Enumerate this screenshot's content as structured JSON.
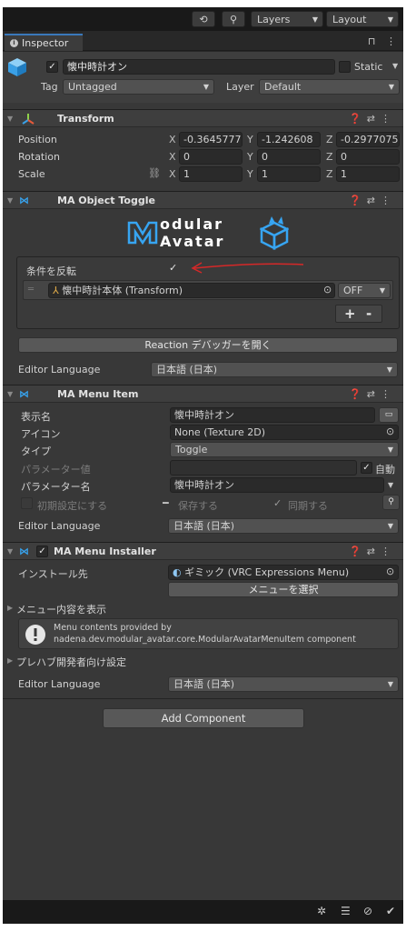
{
  "toolbar": {
    "layers_label": "Layers",
    "layout_label": "Layout"
  },
  "tab": {
    "label": "Inspector"
  },
  "object": {
    "name": "懐中時計オン",
    "static_label": "Static",
    "tag_label": "Tag",
    "tag_value": "Untagged",
    "layer_label": "Layer",
    "layer_value": "Default"
  },
  "transform": {
    "title": "Transform",
    "rows": [
      {
        "label": "Position",
        "x": "-0.3645777",
        "y": "-1.242608",
        "z": "-0.2977075"
      },
      {
        "label": "Rotation",
        "x": "0",
        "y": "0",
        "z": "0"
      },
      {
        "label": "Scale",
        "x": "1",
        "y": "1",
        "z": "1"
      }
    ],
    "axis": {
      "x": "X",
      "y": "Y",
      "z": "Z"
    }
  },
  "object_toggle": {
    "title": "MA Object Toggle",
    "logo_top": "odular",
    "logo_bottom": "Avatar",
    "invert_label": "条件を反転",
    "item_label": "懐中時計本体 (Transform)",
    "item_state": "OFF",
    "plus": "+",
    "minus": "-",
    "reaction_button": "Reaction デバッガーを開く",
    "editor_language_label": "Editor Language",
    "editor_language_value": "日本語 (日本)"
  },
  "menu_item": {
    "title": "MA Menu Item",
    "display_name_label": "表示名",
    "display_name_value": "懐中時計オン",
    "icon_label": "アイコン",
    "icon_value": "None (Texture 2D)",
    "type_label": "タイプ",
    "type_value": "Toggle",
    "param_value_label": "パラメーター値",
    "auto_label": "自動",
    "param_name_label": "パラメーター名",
    "param_name_value": "懐中時計オン",
    "default_label": "初期設定にする",
    "save_label": "保存する",
    "sync_label": "同期する",
    "editor_language_label": "Editor Language",
    "editor_language_value": "日本語 (日本)"
  },
  "menu_installer": {
    "title": "MA Menu Installer",
    "install_target_label": "インストール先",
    "install_target_value": "ギミック (VRC Expressions Menu)",
    "select_menu_button": "メニューを選択",
    "show_contents_label": "メニュー内容を表示",
    "info_line1": "Menu contents provided by",
    "info_line2": "nadena.dev.modular_avatar.core.ModularAvatarMenuItem component",
    "prefab_dev_label": "プレハブ開発者向け設定",
    "editor_language_label": "Editor Language",
    "editor_language_value": "日本語 (日本)"
  },
  "add_component_button": "Add Component",
  "colors": {
    "panel": "#383838",
    "accent_blue": "#37a5f2",
    "annotation_red": "#d62828"
  }
}
